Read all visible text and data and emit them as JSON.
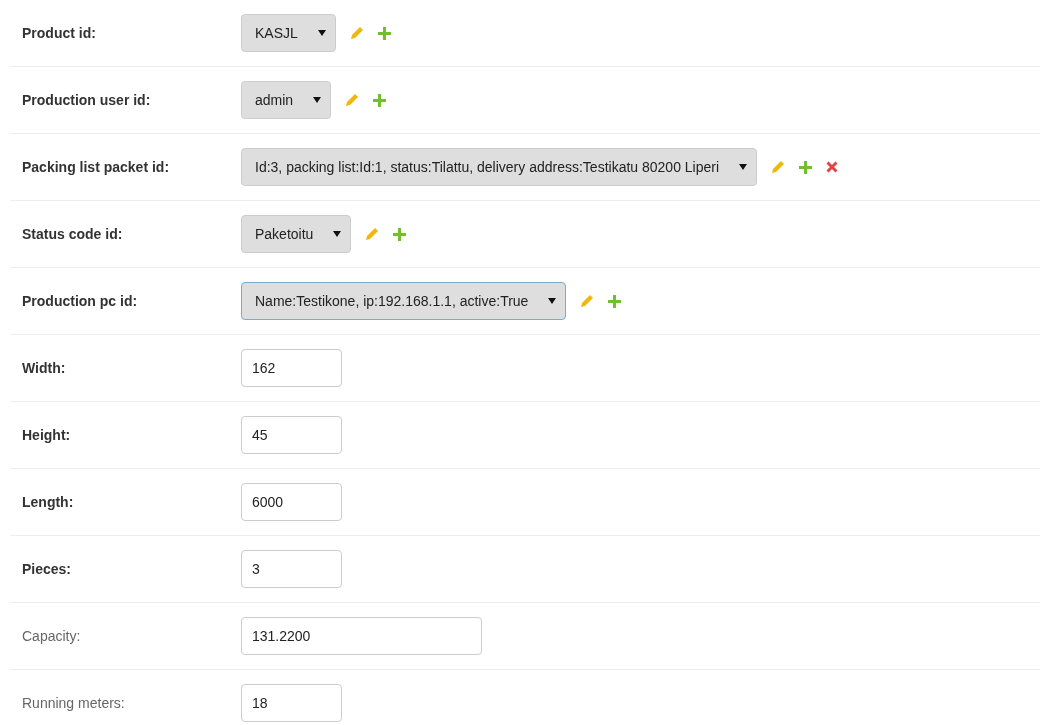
{
  "rows": [
    {
      "label": "Product id:",
      "required": true,
      "kind": "select",
      "value": "KASJL",
      "focused": false,
      "can_change": true,
      "can_add": true,
      "can_delete": false
    },
    {
      "label": "Production user id:",
      "required": true,
      "kind": "select",
      "value": "admin",
      "focused": false,
      "can_change": true,
      "can_add": true,
      "can_delete": false
    },
    {
      "label": "Packing list packet id:",
      "required": true,
      "kind": "select",
      "value": "Id:3, packing list:Id:1, status:Tilattu, delivery address:Testikatu 80200 Liperi",
      "focused": false,
      "can_change": true,
      "can_add": true,
      "can_delete": true
    },
    {
      "label": "Status code id:",
      "required": true,
      "kind": "select",
      "value": "Paketoitu",
      "focused": false,
      "can_change": true,
      "can_add": true,
      "can_delete": false
    },
    {
      "label": "Production pc id:",
      "required": true,
      "kind": "select",
      "value": "Name:Testikone, ip:192.168.1.1, active:True",
      "focused": true,
      "can_change": true,
      "can_add": true,
      "can_delete": false
    },
    {
      "label": "Width:",
      "required": true,
      "kind": "number",
      "value": "162"
    },
    {
      "label": "Height:",
      "required": true,
      "kind": "number",
      "value": "45"
    },
    {
      "label": "Length:",
      "required": true,
      "kind": "number",
      "value": "6000"
    },
    {
      "label": "Pieces:",
      "required": true,
      "kind": "number",
      "value": "3"
    },
    {
      "label": "Capacity:",
      "required": false,
      "kind": "decimal",
      "value": "131.2200"
    },
    {
      "label": "Running meters:",
      "required": false,
      "kind": "number",
      "value": "18"
    }
  ]
}
